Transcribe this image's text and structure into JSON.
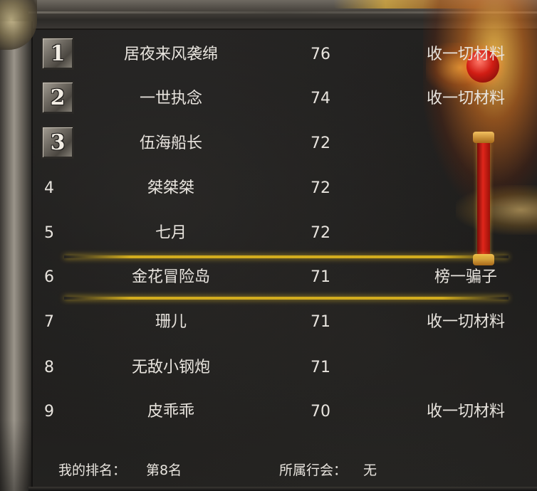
{
  "leaderboard": {
    "rows": [
      {
        "rank": "1",
        "name": "居夜来风袭绵",
        "level": "76",
        "guild": "收一切材料"
      },
      {
        "rank": "2",
        "name": "一世执念",
        "level": "74",
        "guild": "收一切材料"
      },
      {
        "rank": "3",
        "name": "伍海船长",
        "level": "72",
        "guild": ""
      },
      {
        "rank": "4",
        "name": "桀桀桀",
        "level": "72",
        "guild": ""
      },
      {
        "rank": "5",
        "name": "七月",
        "level": "72",
        "guild": ""
      },
      {
        "rank": "6",
        "name": "金花冒险岛",
        "level": "71",
        "guild": "榜一骗子"
      },
      {
        "rank": "7",
        "name": "珊儿",
        "level": "71",
        "guild": "收一切材料"
      },
      {
        "rank": "8",
        "name": "无敌小钢炮",
        "level": "71",
        "guild": ""
      },
      {
        "rank": "9",
        "name": "皮乖乖",
        "level": "70",
        "guild": "收一切材料"
      }
    ],
    "highlighted_rank": "6"
  },
  "footer": {
    "my_rank_label": "我的排名：",
    "my_rank_value": "第8名",
    "guild_label": "所属行会：",
    "guild_value": "无"
  },
  "colors": {
    "text": "#e8e4de",
    "highlight": "#dcb41e",
    "background": "#1c1b1a"
  }
}
